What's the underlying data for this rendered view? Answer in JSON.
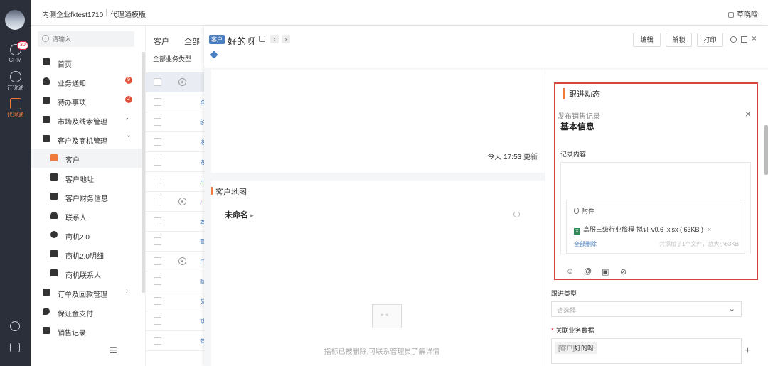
{
  "rail": {
    "items": [
      {
        "label": "CRM",
        "badge": "30"
      },
      {
        "label": "订货通"
      },
      {
        "label": "代理通"
      }
    ]
  },
  "topbar": {
    "company": "内测企业fktest1710",
    "edition": "代理通模版",
    "user": "草晓晗"
  },
  "sidebar": {
    "search_placeholder": "请输入",
    "items": [
      {
        "label": "首页"
      },
      {
        "label": "业务通知",
        "badge": "9"
      },
      {
        "label": "待办事项",
        "badge": "2"
      },
      {
        "label": "市场及线索管理",
        "chevron": "›"
      },
      {
        "label": "客户及商机管理",
        "chevron": "⌄"
      },
      {
        "label": "客户"
      },
      {
        "label": "客户地址"
      },
      {
        "label": "客户财务信息"
      },
      {
        "label": "联系人"
      },
      {
        "label": "商机2.0"
      },
      {
        "label": "商机2.0明细"
      },
      {
        "label": "商机联系人"
      },
      {
        "label": "订单及回款管理",
        "chevron": "›"
      },
      {
        "label": "保证金支付"
      },
      {
        "label": "销售记录"
      }
    ]
  },
  "list": {
    "tabs": [
      "客户",
      "全部"
    ],
    "filter": "全部业务类型",
    "rows": [
      "余",
      "好",
      "多",
      "多",
      "小",
      "小",
      "本",
      "营",
      "广",
      "咖",
      "又",
      "功",
      "营"
    ]
  },
  "detail": {
    "tag": "客户",
    "title": "好的呀",
    "prev": "‹",
    "next": "›",
    "buttons": {
      "edit": "编辑",
      "unlock": "解锁",
      "print": "打印"
    },
    "close": "×",
    "updated": "今天 17:53 更新",
    "map_title": "客户地图",
    "map_unnamed": "未命名",
    "map_arrow": "▸",
    "empty_text": "指标已被删除,可联系管理员了解详情"
  },
  "follow": {
    "title": "跟进动态",
    "publish": "发布销售记录",
    "close": "×",
    "section": "基本信息",
    "record_label": "记录内容",
    "attach_title": "附件",
    "file_icon": "X",
    "file_name": "高服三级行业旅程-拟订-v0.6 .xlsx ( 63KB )",
    "file_remove": "×",
    "delete_all": "全部删除",
    "limit": "共添加了1个文件，总大小63KB",
    "type_label": "跟进类型",
    "type_placeholder": "请选择",
    "type_chevron": "⌄",
    "rel_required": "*",
    "rel_label": "关联业务数据",
    "rel_prefix": "[客户]",
    "rel_value": "好的呀",
    "plus": "+"
  },
  "icons": {
    "emoji": "☺",
    "mention": "@",
    "image": "▣",
    "clip": "⊘"
  },
  "colors": {
    "accent": "#f07a3c",
    "primary": "#4a7fc1",
    "highlight": "#d9453a",
    "rail": "#2b2f3a"
  }
}
